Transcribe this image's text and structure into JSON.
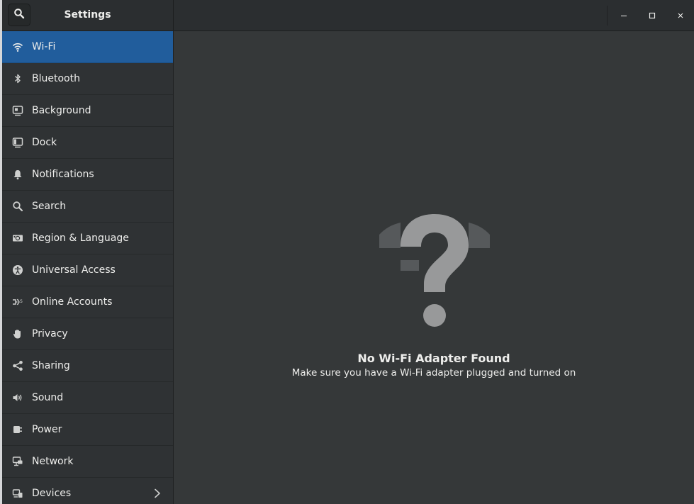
{
  "window": {
    "title": "Settings"
  },
  "sidebar": {
    "items": [
      {
        "label": "Wi-Fi",
        "icon": "wifi-icon",
        "selected": true
      },
      {
        "label": "Bluetooth",
        "icon": "bluetooth-icon"
      },
      {
        "label": "Background",
        "icon": "background-icon"
      },
      {
        "label": "Dock",
        "icon": "dock-icon"
      },
      {
        "label": "Notifications",
        "icon": "bell-icon"
      },
      {
        "label": "Search",
        "icon": "search-icon"
      },
      {
        "label": "Region & Language",
        "icon": "region-icon"
      },
      {
        "label": "Universal Access",
        "icon": "accessibility-icon"
      },
      {
        "label": "Online Accounts",
        "icon": "online-accounts-icon"
      },
      {
        "label": "Privacy",
        "icon": "hand-icon"
      },
      {
        "label": "Sharing",
        "icon": "share-icon"
      },
      {
        "label": "Sound",
        "icon": "speaker-icon"
      },
      {
        "label": "Power",
        "icon": "power-plug-icon"
      },
      {
        "label": "Network",
        "icon": "network-icon"
      },
      {
        "label": "Devices",
        "icon": "devices-icon",
        "has_submenu": true
      }
    ]
  },
  "main": {
    "empty_title": "No Wi-Fi Adapter Found",
    "empty_subtitle": "Make sure you have a Wi-Fi adapter plugged and turned on",
    "empty_icon": "unknown-wifi-question-icon"
  },
  "colors": {
    "accent": "#215d9c",
    "sidebar_bg": "#2f3234",
    "main_bg": "#353839",
    "header_bg": "#2b2e30",
    "text": "#eeeeec"
  }
}
